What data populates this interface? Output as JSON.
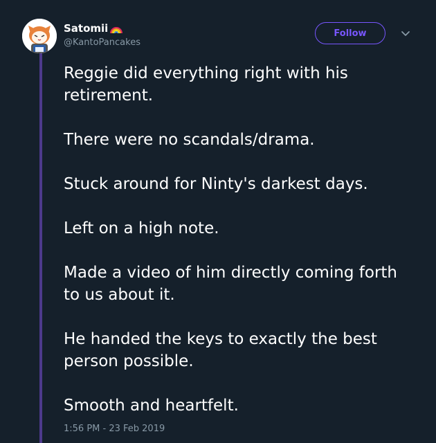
{
  "tweet": {
    "display_name": "Satomii",
    "handle": "@KantoPancakes",
    "follow_label": "Follow",
    "paragraphs": [
      "Reggie did everything right with his retirement.",
      "There were no scandals/drama.",
      "Stuck around for Ninty's darkest days.",
      "Left on a high note.",
      "Made a video of him directly coming forth to us about it.",
      "He handed the keys to exactly the best person possible.",
      "Smooth and heartfelt."
    ],
    "timestamp": "1:56 PM - 23 Feb 2019"
  },
  "icons": {
    "avatar": "aggretsuko-avatar",
    "name_emoji": "rainbow-emoji",
    "menu": "chevron-down-icon"
  },
  "colors": {
    "background": "#15202b",
    "text": "#ffffff",
    "muted": "#8899a6",
    "accent": "#7856ff",
    "thread_line": "#4d3a8c"
  }
}
